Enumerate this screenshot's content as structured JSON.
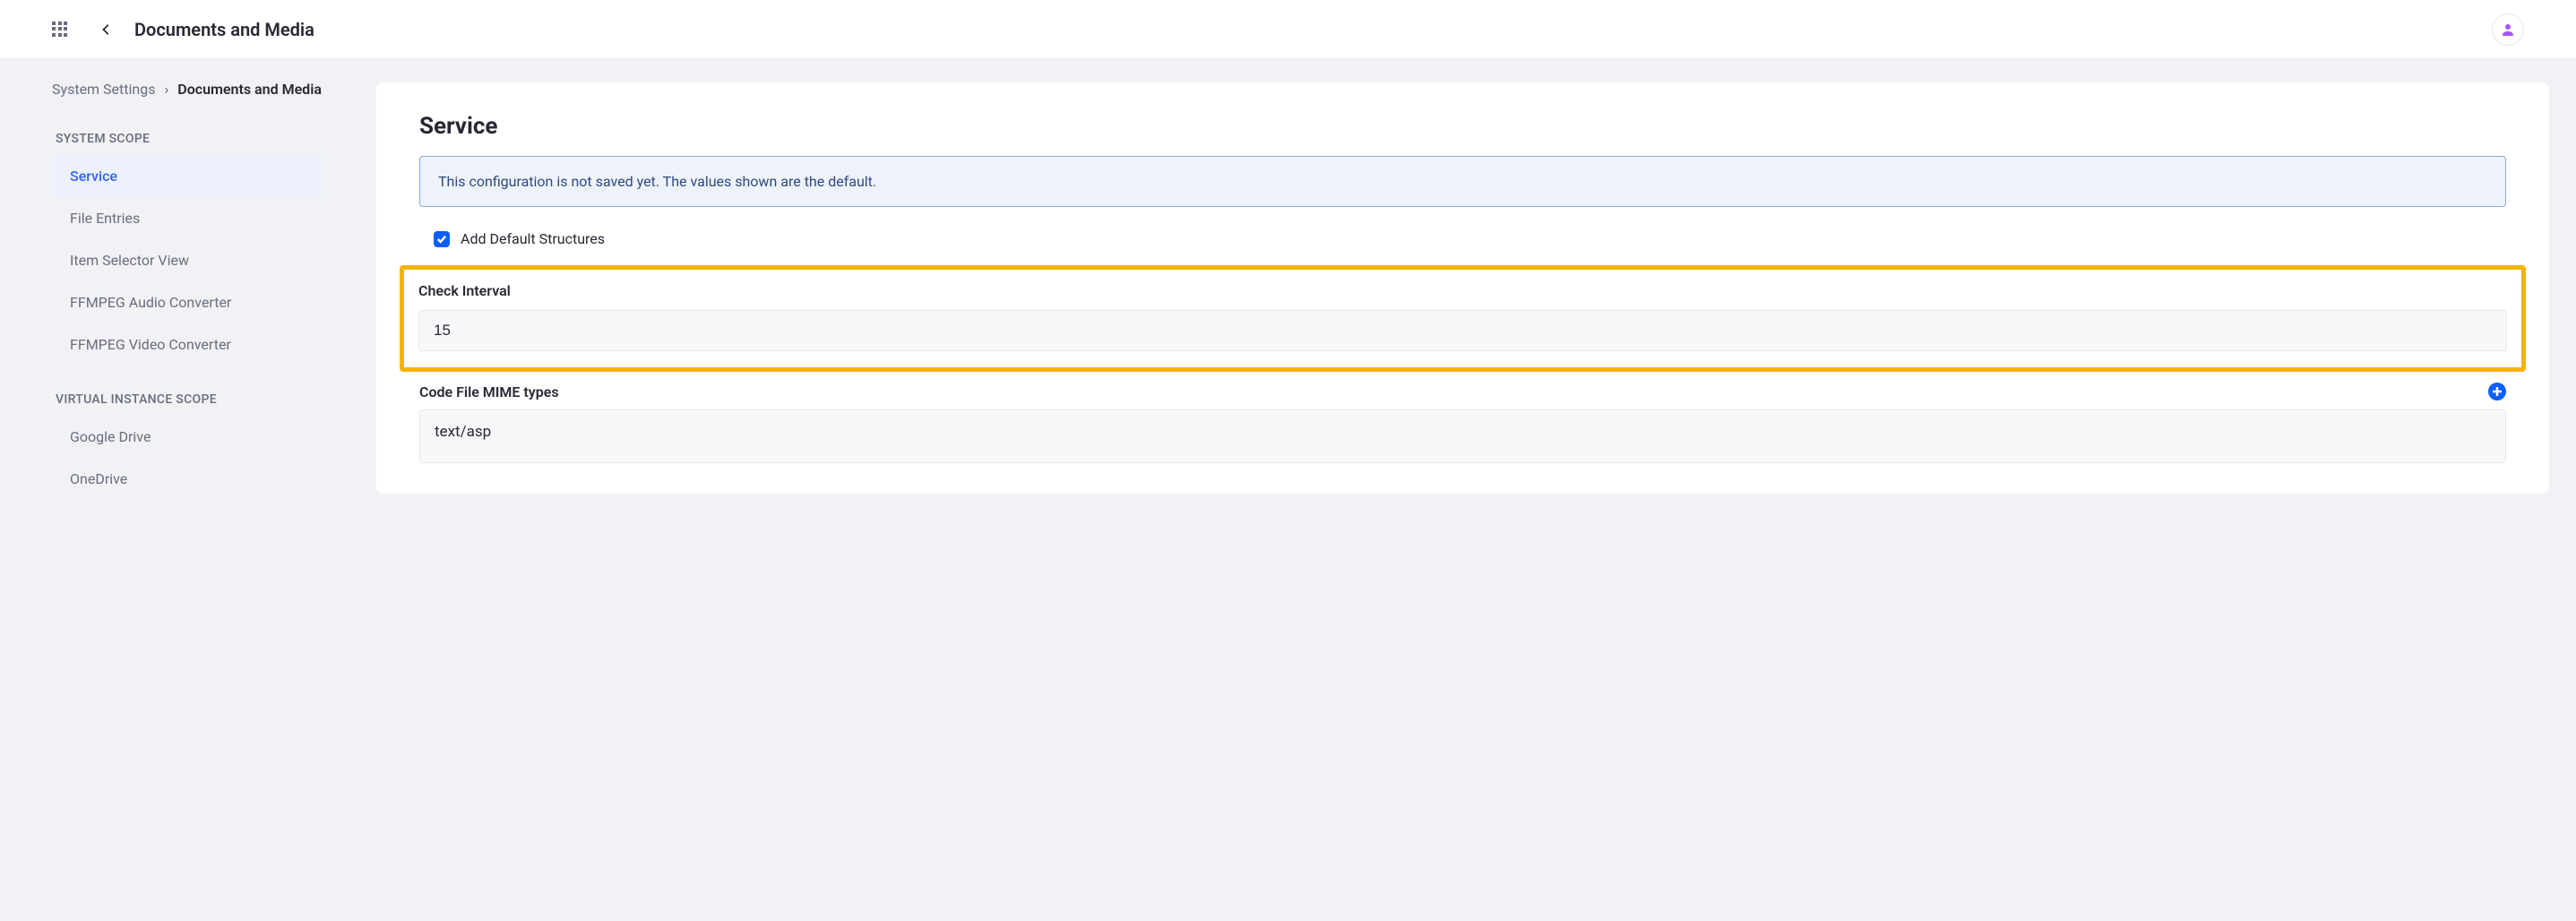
{
  "topbar": {
    "title": "Documents and Media"
  },
  "breadcrumb": {
    "parent": "System Settings",
    "current": "Documents and Media"
  },
  "sidebar": {
    "section1_title": "SYSTEM SCOPE",
    "items1": {
      "0": "Service",
      "1": "File Entries",
      "2": "Item Selector View",
      "3": "FFMPEG Audio Converter",
      "4": "FFMPEG Video Converter"
    },
    "section2_title": "VIRTUAL INSTANCE SCOPE",
    "items2": {
      "0": "Google Drive",
      "1": "OneDrive"
    }
  },
  "main": {
    "title": "Service",
    "alert": "This configuration is not saved yet. The values shown are the default.",
    "checkbox_label": "Add Default Structures",
    "check_interval_label": "Check Interval",
    "check_interval_value": "15",
    "mime_label": "Code File MIME types",
    "mime_value": "text/asp"
  }
}
